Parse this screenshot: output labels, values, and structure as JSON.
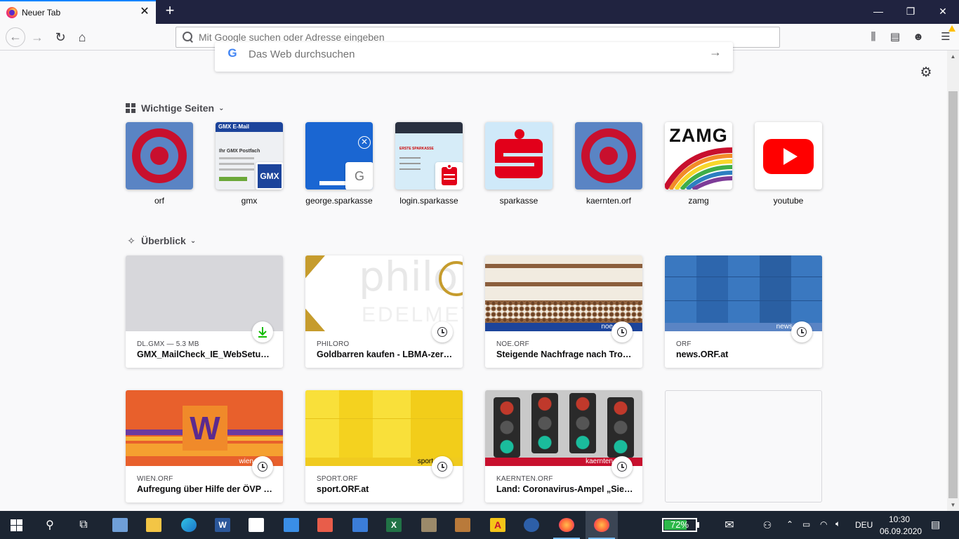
{
  "tab": {
    "title": "Neuer Tab",
    "close": "✕"
  },
  "newtab": "+",
  "window_controls": {
    "minimize": "—",
    "maximize": "❐",
    "close": "✕"
  },
  "nav": {
    "back": "←",
    "forward": "→",
    "reload": "↻",
    "home": "⌂"
  },
  "urlbar": {
    "placeholder": "Mit Google suchen oder Adresse eingeben"
  },
  "toolbar": {
    "library": "⫼",
    "sidebar": "▤",
    "account": "☻",
    "menu": "☰"
  },
  "search": {
    "logo": "G",
    "placeholder": "Das Web durchsuchen",
    "arrow": "→"
  },
  "settings_icon": "⚙",
  "topsites": {
    "heading": "Wichtige Seiten",
    "chevron": "⌄",
    "items": [
      {
        "label": "orf",
        "icon": "orf-target"
      },
      {
        "label": "gmx",
        "icon": "gmx-screenshot",
        "badge": "GMX",
        "header": "GMX E-Mail",
        "postfach": "Ihr GMX Postfach"
      },
      {
        "label": "george.sparkasse",
        "icon": "george-screenshot",
        "badge": "G"
      },
      {
        "label": "login.sparkasse",
        "icon": "sparkasse-screenshot",
        "brand": "ERSTE SPARKASSE"
      },
      {
        "label": "sparkasse",
        "icon": "sparkasse-s"
      },
      {
        "label": "kaernten.orf",
        "icon": "orf-target"
      },
      {
        "label": "zamg",
        "icon": "zamg-logo",
        "logo_text": "ZAMG"
      },
      {
        "label": "youtube",
        "icon": "youtube-play"
      }
    ]
  },
  "highlights": {
    "heading": "Überblick",
    "chevron": "⌄",
    "items": [
      {
        "meta": "DL.GMX — 5.3 MB",
        "title": "GMX_MailCheck_IE_WebSetup_sp...",
        "badge": "download-icon"
      },
      {
        "meta": "PHILORO",
        "title": "Goldbarren kaufen - LBMA-zertifiz...",
        "badge": "clock-icon",
        "overlay": "philo",
        "overlay2": "EDELMET"
      },
      {
        "meta": "NOE.ORF",
        "title": "Steigende Nachfrage nach Trocke...",
        "badge": "clock-icon",
        "strip": "noe"
      },
      {
        "meta": "ORF",
        "title": "news.ORF.at",
        "badge": "clock-icon",
        "strip": "news"
      },
      {
        "meta": "WIEN.ORF",
        "title": "Aufregung über Hilfe der ÖVP bei ...",
        "badge": "clock-icon",
        "strip": "wien",
        "logo": "W"
      },
      {
        "meta": "SPORT.ORF",
        "title": "sport.ORF.at",
        "badge": "clock-icon",
        "strip": "sport"
      },
      {
        "meta": "KAERNTEN.ORF",
        "title": "Land: Coronavirus-Ampel „Sieg de...",
        "badge": "clock-icon",
        "strip": "kaernten"
      }
    ]
  },
  "taskbar": {
    "battery_percent": "72%",
    "battery_level": 0.72,
    "language": "DEU",
    "time": "10:30",
    "date": "06.09.2020"
  },
  "colors": {
    "accent": "#0a84ff",
    "orf_red": "#c8102e",
    "orf_blue": "#5a84c4",
    "sparkasse_red": "#e2001a",
    "tabstrip": "#202340"
  }
}
